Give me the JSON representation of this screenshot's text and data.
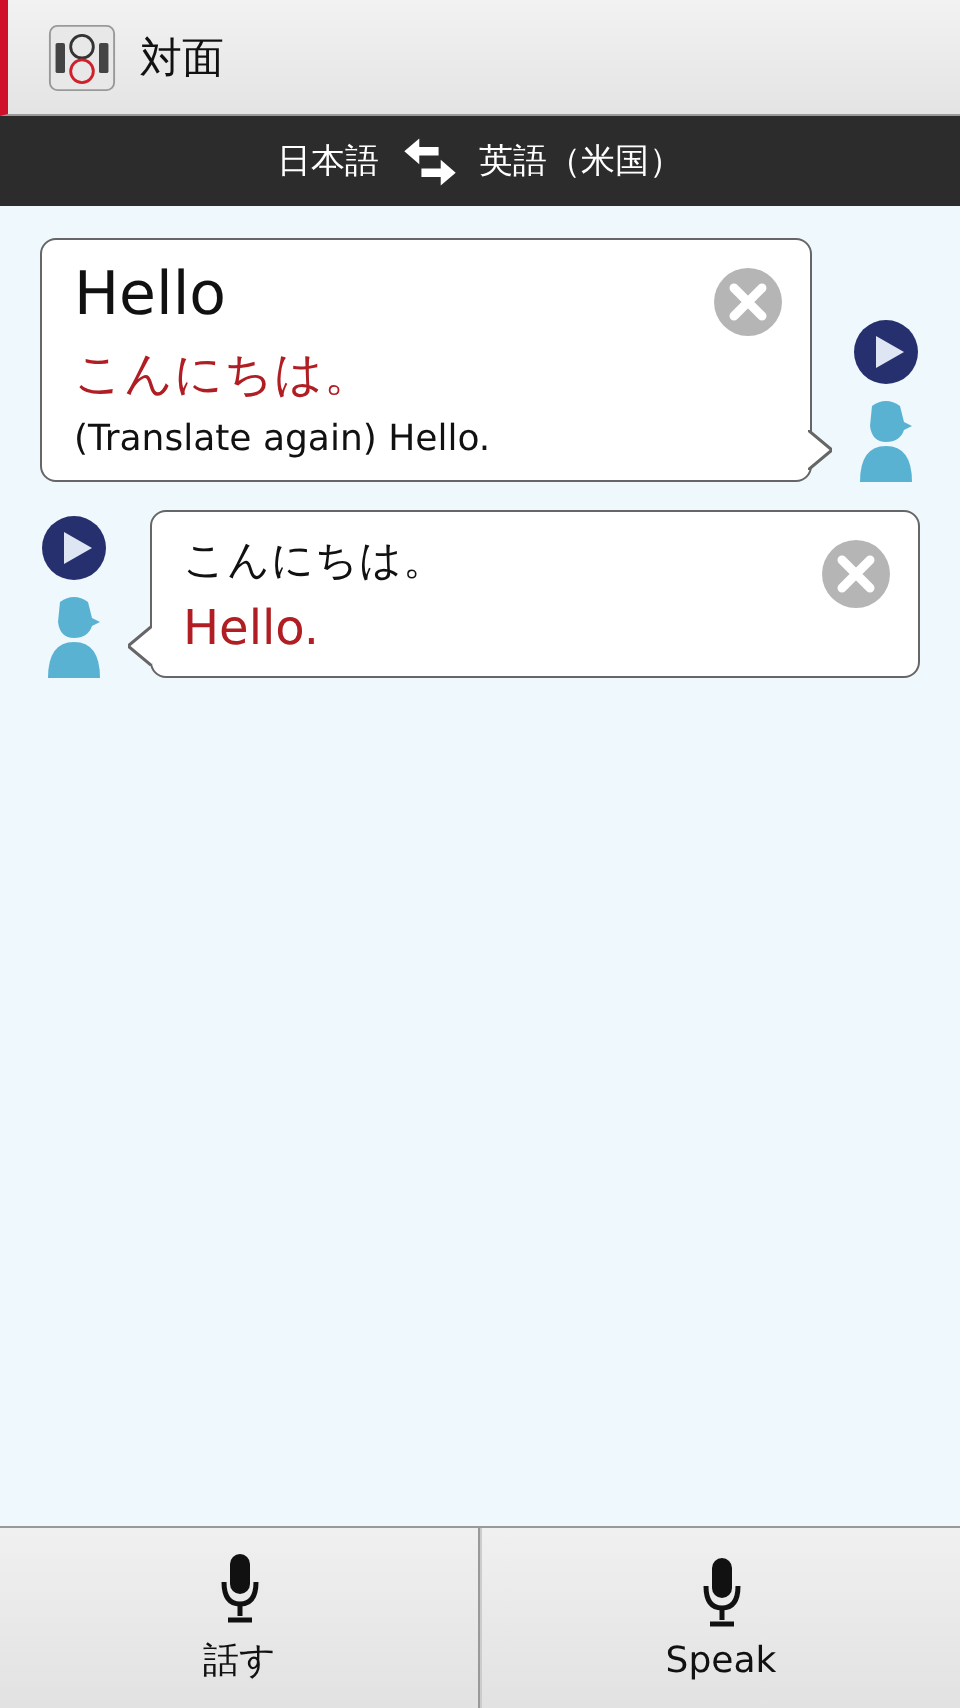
{
  "title_bar": {
    "title": "対面"
  },
  "language_bar": {
    "source": "日本語",
    "target": "英語（米国）"
  },
  "messages": [
    {
      "kind": "right",
      "source": "Hello",
      "translation": "こんにちは。",
      "retranslation": "(Translate again) Hello."
    },
    {
      "kind": "left",
      "source": "こんにちは。",
      "translation": "Hello."
    }
  ],
  "buttons": [
    {
      "label": "話す"
    },
    {
      "label": "Speak"
    }
  ]
}
